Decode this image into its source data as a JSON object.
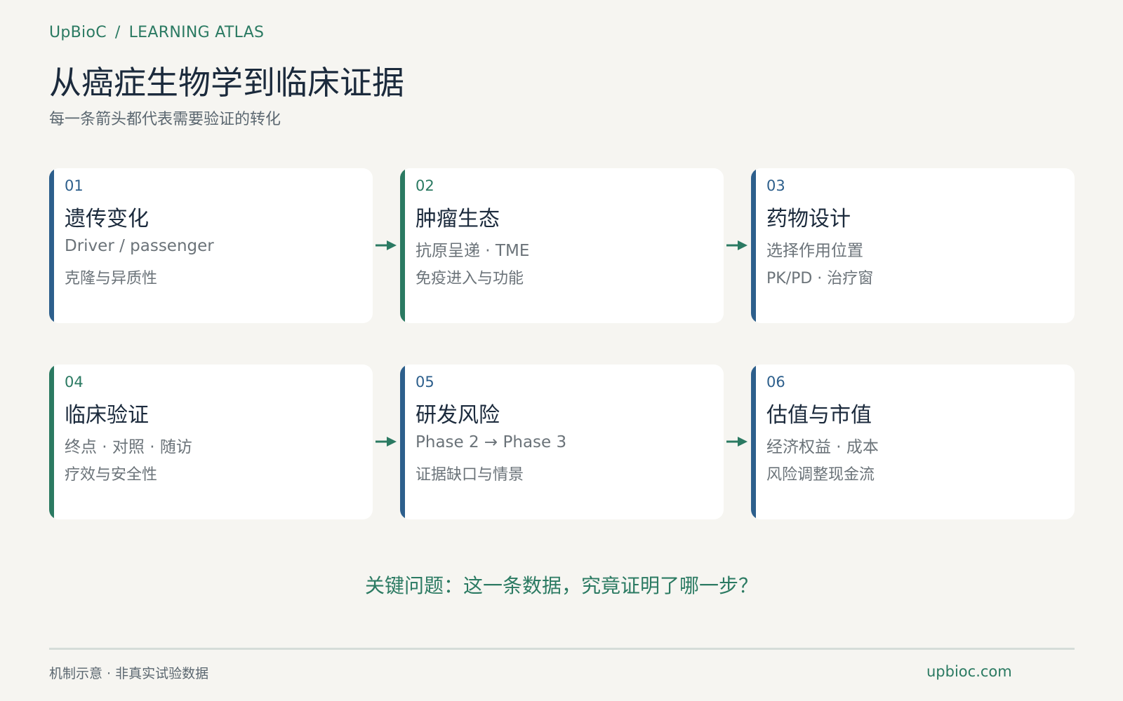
{
  "header": {
    "brand": "UpBioC",
    "separator": "/",
    "section": "LEARNING ATLAS",
    "title": "从癌症生物学到临床证据",
    "subtitle": "每一条箭头都代表需要验证的转化"
  },
  "colors": {
    "background": "#f6f5f1",
    "accent_green": "#2b7a62",
    "accent_blue": "#2d5f8c",
    "card": "#ffffff",
    "text_dark": "#1b2a3c",
    "text_muted": "#6b7379"
  },
  "steps": [
    {
      "num": "01",
      "name": "遗传变化",
      "line1": "Driver / passenger",
      "line2": "克隆与异质性",
      "accent": "#2d5f8c"
    },
    {
      "num": "02",
      "name": "肿瘤生态",
      "line1": "抗原呈递 · TME",
      "line2": "免疫进入与功能",
      "accent": "#2b7a62"
    },
    {
      "num": "03",
      "name": "药物设计",
      "line1": "选择作用位置",
      "line2": "PK/PD · 治疗窗",
      "accent": "#2d5f8c"
    },
    {
      "num": "04",
      "name": "临床验证",
      "line1": "终点 · 对照 · 随访",
      "line2": "疗效与安全性",
      "accent": "#2b7a62"
    },
    {
      "num": "05",
      "name": "研发风险",
      "line1": "Phase 2 → Phase 3",
      "line2": "证据缺口与情景",
      "accent": "#2d5f8c"
    },
    {
      "num": "06",
      "name": "估值与市值",
      "line1": "经济权益 · 成本",
      "line2": "风险调整现金流",
      "accent": "#2d5f8c"
    }
  ],
  "connectors": [
    {
      "from": "01",
      "to": "02",
      "icon": "arrow-right-icon"
    },
    {
      "from": "02",
      "to": "03",
      "icon": "arrow-right-icon"
    },
    {
      "from": "04",
      "to": "05",
      "icon": "arrow-right-icon"
    },
    {
      "from": "05",
      "to": "06",
      "icon": "arrow-right-icon"
    }
  ],
  "question": "关键问题：这一条数据，究竟证明了哪一步？",
  "footer": {
    "note": "机制示意 · 非真实试验数据",
    "site": "upbioc.com"
  }
}
